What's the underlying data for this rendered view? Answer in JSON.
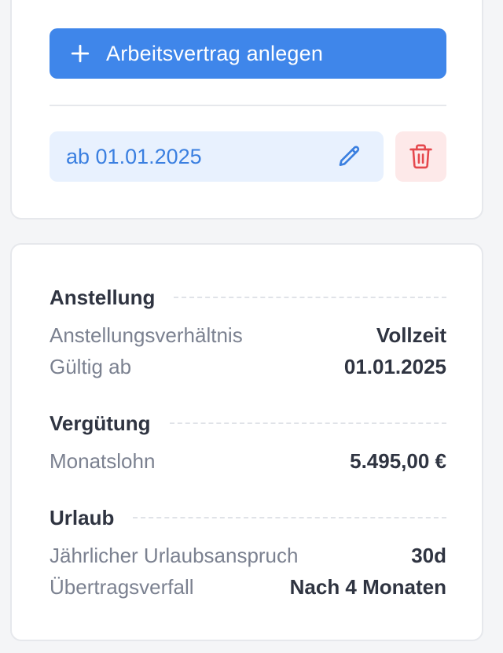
{
  "actions": {
    "add_contract_label": "Arbeitsvertrag anlegen"
  },
  "contract": {
    "label": "ab 01.01.2025"
  },
  "details": {
    "sections": [
      {
        "title": "Anstellung",
        "rows": [
          {
            "label": "Anstellungsverhältnis",
            "value": "Vollzeit"
          },
          {
            "label": "Gültig ab",
            "value": "01.01.2025"
          }
        ]
      },
      {
        "title": "Vergütung",
        "rows": [
          {
            "label": "Monatslohn",
            "value": "5.495,00 €"
          }
        ]
      },
      {
        "title": "Urlaub",
        "rows": [
          {
            "label": "Jährlicher Urlaubsanspruch",
            "value": "30d"
          },
          {
            "label": "Übertragsverfall",
            "value": "Nach 4 Monaten"
          }
        ]
      }
    ]
  },
  "icons": {
    "add": "plus-icon",
    "edit": "pencil-icon",
    "delete": "trash-icon"
  },
  "colors": {
    "primary": "#3f86ea",
    "chip_bg": "#e8f1fe",
    "chip_text": "#3a7fe0",
    "danger": "#e5484d",
    "danger_bg": "#fde9e9"
  }
}
